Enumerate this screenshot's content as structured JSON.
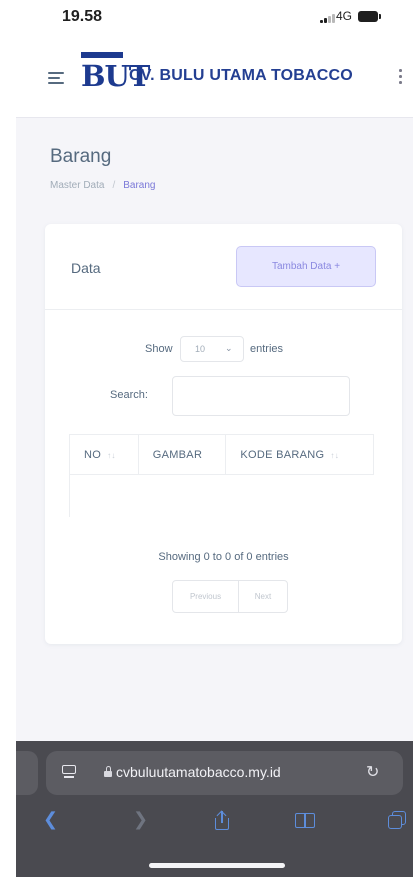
{
  "status_bar": {
    "time": "19.58",
    "network": "4G"
  },
  "navbar": {
    "logo_text": "BUT",
    "brand_name": "CV. BULU UTAMA TOBACCO",
    "menu_icon": "hamburger-menu-icon",
    "more_icon": "vertical-dots-icon"
  },
  "page": {
    "title": "Barang",
    "breadcrumb": [
      "Master Data",
      "/",
      "Barang"
    ]
  },
  "card": {
    "title": "Data",
    "add_button": "Tambah Data +"
  },
  "datatable": {
    "show_label": "Show",
    "entries_value": "10",
    "entries_label": "entries",
    "search_label": "Search:",
    "search_value": "",
    "columns": [
      "NO",
      "GAMBAR",
      "KODE BARANG"
    ],
    "rows": [],
    "info": "Showing 0 to 0 of 0 entries",
    "previous_label": "Previous",
    "next_label": "Next"
  },
  "browser": {
    "url": "cvbuluutamatobacco.my.id"
  },
  "colors": {
    "brand_blue": "#1d3a8f",
    "primary_light": "#e7e7ff",
    "primary_text": "#8a88e0",
    "safari_bar": "#4a4a50",
    "safari_accent": "#5d8ddb"
  }
}
